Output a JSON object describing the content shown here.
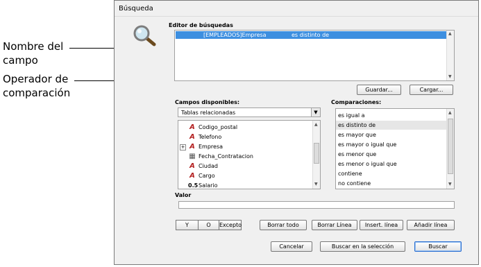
{
  "annotations": {
    "field_name": "Nombre del campo",
    "operator": "Operador de comparación"
  },
  "dialog": {
    "title": "Búsqueda",
    "editor_label": "Editor de búsquedas",
    "editor_line": {
      "field": "[EMPLEADOS]Empresa",
      "operator": "es distinto de"
    },
    "save_label": "Guardar...",
    "load_label": "Cargar...",
    "fields_label": "Campos disponibles:",
    "table_select": "Tablas relacionadas",
    "fields": [
      {
        "icon": "text-field-icon",
        "glyph": "A",
        "name": "Codigo_postal",
        "expander": false
      },
      {
        "icon": "text-field-icon",
        "glyph": "A",
        "name": "Telefono",
        "expander": false
      },
      {
        "icon": "text-field-icon",
        "glyph": "A",
        "name": "Empresa",
        "expander": true
      },
      {
        "icon": "date-field-icon",
        "glyph": "▦",
        "name": "Fecha_Contratacion",
        "expander": false
      },
      {
        "icon": "text-field-icon",
        "glyph": "A",
        "name": "Ciudad",
        "expander": false
      },
      {
        "icon": "text-field-icon",
        "glyph": "A",
        "name": "Cargo",
        "expander": false
      },
      {
        "icon": "number-field-icon",
        "glyph": "0.5",
        "name": "Salario",
        "expander": false
      }
    ],
    "comparisons_label": "Comparaciones:",
    "comparisons": [
      "es igual a",
      "es distinto de",
      "es mayor que",
      "es mayor o igual que",
      "es menor que",
      "es menor o igual que",
      "contiene",
      "no contiene"
    ],
    "selected_comparison": 1,
    "value_label": "Valor",
    "value": "",
    "and_label": "Y",
    "or_label": "O",
    "except_label": "Excepto",
    "clear_all_label": "Borrar todo",
    "clear_line_label": "Borrar Línea",
    "insert_line_label": "Insert. línea",
    "add_line_label": "Añadir línea",
    "cancel_label": "Cancelar",
    "search_selection_label": "Buscar en la selección",
    "search_label": "Buscar"
  }
}
